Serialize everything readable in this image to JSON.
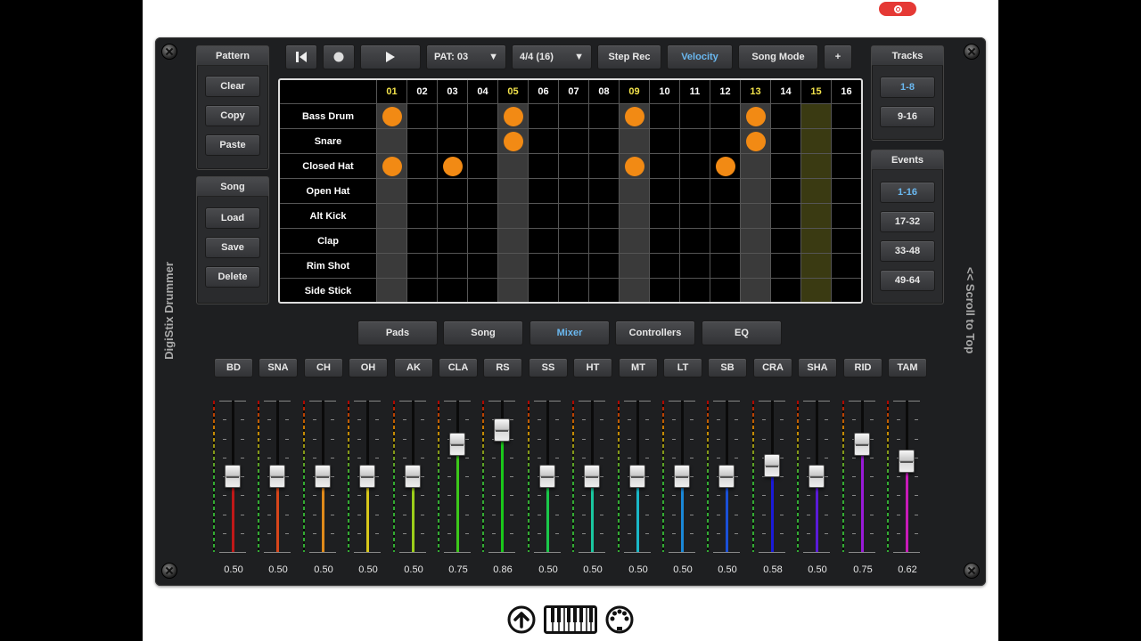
{
  "app_title": "DigiStix Drummer",
  "scroll_label": "<< Scroll to Top",
  "transport": {
    "pattern_select": "PAT: 03",
    "time_signature": "4/4 (16)",
    "step_rec": "Step Rec",
    "velocity": "Velocity",
    "song_mode": "Song Mode",
    "add": "+"
  },
  "pattern_panel": {
    "title": "Pattern",
    "clear": "Clear",
    "copy": "Copy",
    "paste": "Paste"
  },
  "song_panel": {
    "title": "Song",
    "load": "Load",
    "save": "Save",
    "delete": "Delete"
  },
  "tracks_panel": {
    "title": "Tracks",
    "items": [
      "1-8",
      "9-16"
    ],
    "selected": "1-8"
  },
  "events_panel": {
    "title": "Events",
    "items": [
      "1-16",
      "17-32",
      "33-48",
      "49-64"
    ],
    "selected": "1-16"
  },
  "grid": {
    "steps": [
      "01",
      "02",
      "03",
      "04",
      "05",
      "06",
      "07",
      "08",
      "09",
      "10",
      "11",
      "12",
      "13",
      "14",
      "15",
      "16"
    ],
    "beat_steps": [
      1,
      5,
      9,
      13
    ],
    "playhead_step": 15,
    "rows": [
      {
        "name": "Bass Drum",
        "notes": [
          1,
          5,
          9,
          13
        ]
      },
      {
        "name": "Snare",
        "notes": [
          5,
          13
        ]
      },
      {
        "name": "Closed Hat",
        "notes": [
          1,
          3,
          9,
          12
        ]
      },
      {
        "name": "Open Hat",
        "notes": []
      },
      {
        "name": "Alt Kick",
        "notes": []
      },
      {
        "name": "Clap",
        "notes": []
      },
      {
        "name": "Rim Shot",
        "notes": []
      },
      {
        "name": "Side Stick",
        "notes": []
      }
    ],
    "note_color": "#f28a14"
  },
  "tabs": {
    "items": [
      "Pads",
      "Song",
      "Mixer",
      "Controllers",
      "EQ"
    ],
    "selected": "Mixer"
  },
  "mixer": {
    "channels": [
      {
        "name": "BD",
        "value": "0.50",
        "level": 0.5,
        "color": "#c01818"
      },
      {
        "name": "SNA",
        "value": "0.50",
        "level": 0.5,
        "color": "#d8461a"
      },
      {
        "name": "CH",
        "value": "0.50",
        "level": 0.5,
        "color": "#e08a1a"
      },
      {
        "name": "OH",
        "value": "0.50",
        "level": 0.5,
        "color": "#d8c81a"
      },
      {
        "name": "AK",
        "value": "0.50",
        "level": 0.5,
        "color": "#9ccf1a"
      },
      {
        "name": "CLA",
        "value": "0.75",
        "level": 0.75,
        "color": "#3cc81a"
      },
      {
        "name": "RS",
        "value": "0.86",
        "level": 0.86,
        "color": "#1ac81a"
      },
      {
        "name": "SS",
        "value": "0.50",
        "level": 0.5,
        "color": "#1ac84a"
      },
      {
        "name": "HT",
        "value": "0.50",
        "level": 0.5,
        "color": "#1ac8a0"
      },
      {
        "name": "MT",
        "value": "0.50",
        "level": 0.5,
        "color": "#1ab8c8"
      },
      {
        "name": "LT",
        "value": "0.50",
        "level": 0.5,
        "color": "#1a88d8"
      },
      {
        "name": "SB",
        "value": "0.50",
        "level": 0.5,
        "color": "#1a50d8"
      },
      {
        "name": "CRA",
        "value": "0.58",
        "level": 0.58,
        "color": "#1a1ad8"
      },
      {
        "name": "SHA",
        "value": "0.50",
        "level": 0.5,
        "color": "#5a1ad8"
      },
      {
        "name": "RID",
        "value": "0.75",
        "level": 0.75,
        "color": "#9a1ad8"
      },
      {
        "name": "TAM",
        "value": "0.62",
        "level": 0.62,
        "color": "#c81ab8"
      }
    ]
  },
  "bottom_icons": [
    "upload-icon",
    "keyboard-icon",
    "midi-icon"
  ]
}
